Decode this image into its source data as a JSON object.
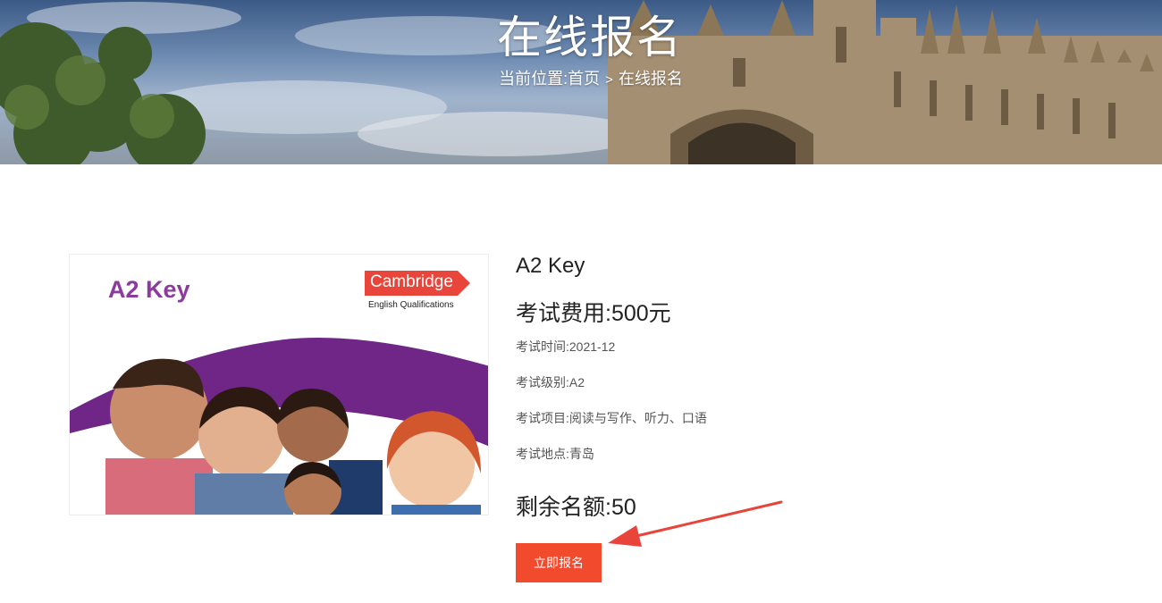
{
  "banner": {
    "title": "在线报名",
    "breadcrumb_prefix": "当前位置:",
    "breadcrumb_home": "首页",
    "breadcrumb_separator": ">",
    "breadcrumb_current": "在线报名"
  },
  "product_image": {
    "title": "A2 Key",
    "logo_text": "Cambridge",
    "logo_subtitle": "English Qualifications",
    "brand_purple": "#7b2d8e",
    "logo_red": "#e8463b"
  },
  "exam": {
    "name": "A2 Key",
    "fee_label": "考试费用:",
    "fee_value": "500元",
    "details": [
      {
        "label": "考试时间:",
        "value": "2021-12"
      },
      {
        "label": "考试级别:",
        "value": "A2"
      },
      {
        "label": "考试项目:",
        "value": "阅读与写作、听力、口语"
      },
      {
        "label": "考试地点:",
        "value": "青岛"
      }
    ],
    "remaining_label": "剩余名额:",
    "remaining_value": "50"
  },
  "actions": {
    "signup_label": "立即报名",
    "accent_color": "#f24a2d"
  }
}
